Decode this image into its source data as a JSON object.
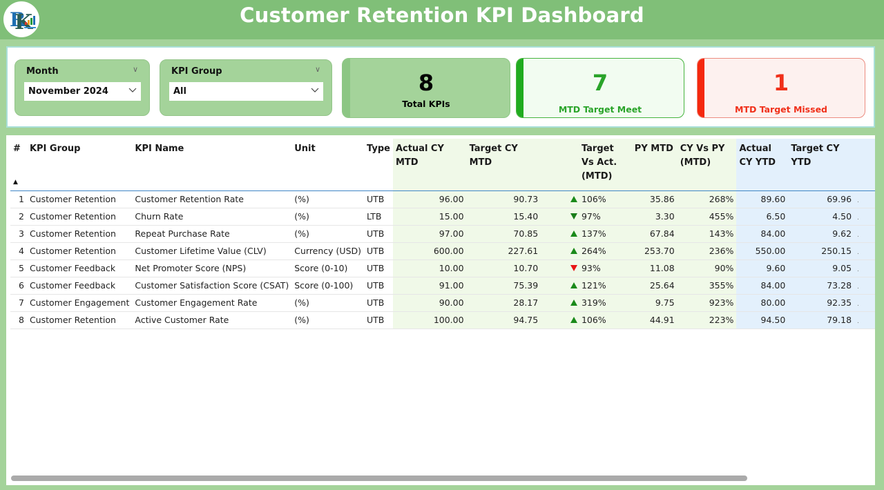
{
  "header": {
    "title": "Customer Retention KPI Dashboard",
    "logo_icon": "company-logo-icon"
  },
  "filters": {
    "month": {
      "label": "Month",
      "value": "November 2024"
    },
    "kpi_group": {
      "label": "KPI Group",
      "value": "All"
    }
  },
  "cards": {
    "total": {
      "value": "8",
      "label": "Total KPIs"
    },
    "meet": {
      "value": "7",
      "label": "MTD Target Meet"
    },
    "missed": {
      "value": "1",
      "label": "MTD Target Missed"
    }
  },
  "colors": {
    "header_bg": "#80bf78",
    "panel_bg": "#a4d39a",
    "meet_green": "#2aa42a",
    "missed_red": "#f0301a",
    "mtd_col_bg": "#f0f9e8",
    "ytd_col_bg": "#e3f0fc"
  },
  "table": {
    "columns": [
      "#",
      "KPI Group",
      "KPI Name",
      "Unit",
      "Type",
      "Actual CY MTD",
      "Target CY MTD",
      "",
      "Target Vs Act. (MTD)",
      "PY MTD",
      "CY Vs PY (MTD)",
      "Actual CY YTD",
      "Target CY YTD"
    ],
    "header": {
      "num": "#",
      "group": "KPI Group",
      "name": "KPI Name",
      "unit": "Unit",
      "type": "Type",
      "actual_mtd": "Actual CY MTD",
      "target_mtd": "Target CY MTD",
      "tva_mtd": "Target Vs Act. (MTD)",
      "py_mtd": "PY MTD",
      "cyvspy_mtd": "CY Vs PY (MTD)",
      "actual_ytd": "Actual CY YTD",
      "target_ytd": "Target CY YTD"
    },
    "sort_indicator": "▲",
    "rows": [
      {
        "num": "1",
        "group": "Customer Retention",
        "name": "Customer Retention Rate",
        "unit": "(%)",
        "type": "UTB",
        "actual_mtd": "96.00",
        "target_mtd": "90.73",
        "trend": "up",
        "trend_color": "green",
        "tva": "106%",
        "py_mtd": "35.86",
        "cyvspy": "268%",
        "actual_ytd": "89.60",
        "target_ytd": "69.96"
      },
      {
        "num": "2",
        "group": "Customer Retention",
        "name": "Churn Rate",
        "unit": "(%)",
        "type": "LTB",
        "actual_mtd": "15.00",
        "target_mtd": "15.40",
        "trend": "down",
        "trend_color": "green",
        "tva": "97%",
        "py_mtd": "3.30",
        "cyvspy": "455%",
        "actual_ytd": "6.50",
        "target_ytd": "4.50"
      },
      {
        "num": "3",
        "group": "Customer Retention",
        "name": "Repeat Purchase Rate",
        "unit": "(%)",
        "type": "UTB",
        "actual_mtd": "97.00",
        "target_mtd": "70.85",
        "trend": "up",
        "trend_color": "green",
        "tva": "137%",
        "py_mtd": "67.84",
        "cyvspy": "143%",
        "actual_ytd": "84.00",
        "target_ytd": "9.62"
      },
      {
        "num": "4",
        "group": "Customer Retention",
        "name": "Customer Lifetime Value (CLV)",
        "unit": "Currency (USD)",
        "type": "UTB",
        "actual_mtd": "600.00",
        "target_mtd": "227.61",
        "trend": "up",
        "trend_color": "green",
        "tva": "264%",
        "py_mtd": "253.70",
        "cyvspy": "236%",
        "actual_ytd": "550.00",
        "target_ytd": "250.15"
      },
      {
        "num": "5",
        "group": "Customer Feedback",
        "name": "Net Promoter Score (NPS)",
        "unit": "Score (0-10)",
        "type": "UTB",
        "actual_mtd": "10.00",
        "target_mtd": "10.70",
        "trend": "down",
        "trend_color": "red",
        "tva": "93%",
        "py_mtd": "11.08",
        "cyvspy": "90%",
        "actual_ytd": "9.60",
        "target_ytd": "9.05"
      },
      {
        "num": "6",
        "group": "Customer Feedback",
        "name": "Customer Satisfaction Score (CSAT)",
        "unit": "Score (0-100)",
        "type": "UTB",
        "actual_mtd": "91.00",
        "target_mtd": "75.39",
        "trend": "up",
        "trend_color": "green",
        "tva": "121%",
        "py_mtd": "25.64",
        "cyvspy": "355%",
        "actual_ytd": "84.00",
        "target_ytd": "73.28"
      },
      {
        "num": "7",
        "group": "Customer Engagement",
        "name": "Customer Engagement Rate",
        "unit": "(%)",
        "type": "UTB",
        "actual_mtd": "90.00",
        "target_mtd": "28.17",
        "trend": "up",
        "trend_color": "green",
        "tva": "319%",
        "py_mtd": "9.75",
        "cyvspy": "923%",
        "actual_ytd": "80.00",
        "target_ytd": "92.35"
      },
      {
        "num": "8",
        "group": "Customer Retention",
        "name": "Active Customer Rate",
        "unit": "(%)",
        "type": "UTB",
        "actual_mtd": "100.00",
        "target_mtd": "94.75",
        "trend": "up",
        "trend_color": "green",
        "tva": "106%",
        "py_mtd": "44.91",
        "cyvspy": "223%",
        "actual_ytd": "94.50",
        "target_ytd": "79.18"
      }
    ]
  }
}
